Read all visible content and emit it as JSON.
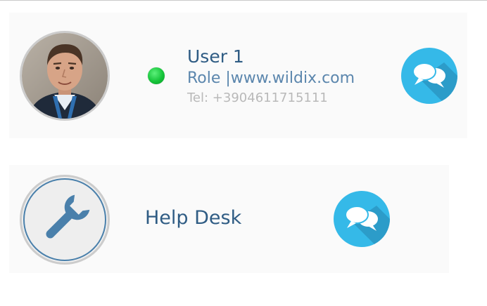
{
  "contacts": [
    {
      "name": "User 1",
      "role": "Role |www.wildix.com",
      "tel": "Tel: +3904611715111",
      "status": "online",
      "status_color": "#16c43a",
      "avatar": "user-photo",
      "action_icon": "chat-bubbles-icon"
    },
    {
      "name": "Help Desk",
      "avatar": "wrench-icon",
      "action_icon": "chat-bubbles-icon"
    }
  ],
  "colors": {
    "name_text": "#2f5c84",
    "role_text": "#5b86ad",
    "tel_text": "#b9b9b9",
    "chat_icon_bg": "#35b9e8",
    "wrench_icon": "#4a80ab",
    "card_bg": "#fafafa"
  }
}
